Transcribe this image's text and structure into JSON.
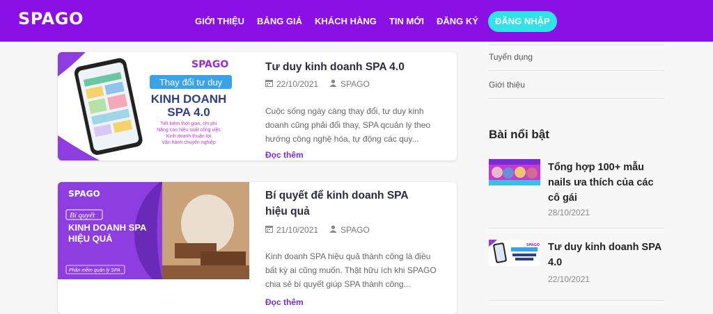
{
  "brand": {
    "logo": "SPAGO",
    "primary_color": "#8b10e6",
    "accent_color": "#2fe4e8"
  },
  "nav": {
    "items": [
      "GIỚI THIỆU",
      "BẢNG GIÁ",
      "KHÁCH HÀNG",
      "TIN MỚI",
      "ĐĂNG KÝ"
    ],
    "login": "ĐĂNG NHẬP"
  },
  "posts": [
    {
      "title": "Tư duy kinh doanh SPA 4.0",
      "date": "22/10/2021",
      "author": "SPAGO",
      "excerpt": "Cuộc sống ngày càng thay đổi, tư duy kinh doanh cũng phải đổi thay, SPA qcuản lý theo hướng công nghệ hóa, tự động các quy...",
      "read_more": "Đọc thêm",
      "thumb": {
        "brand": "SPAGO",
        "tag": "Thay đổi tư duy",
        "headline": "KINH DOANH SPA 4.0",
        "bullets": [
          "Tiết kiệm thời gian, chi phí",
          "Nâng cao hiệu suất công việc",
          "Kinh doanh thuận lợi",
          "Vận hành chuyên nghiệp"
        ]
      }
    },
    {
      "title": "Bí quyết để kinh doanh SPA hiệu quả",
      "date": "21/10/2021",
      "author": "SPAGO",
      "excerpt": "Kinh doanh SPA hiệu quả thành công là điều bất kỳ ai cũng muốn. Thật hữu ích khi SPAGO chia sẻ bí quyết giúp SPA thành công...",
      "read_more": "Đọc thêm",
      "thumb": {
        "brand": "SPAGO",
        "tag": "Bí quyết",
        "headline": "KINH DOANH SPA HIỆU QUẢ",
        "footer": "Phần mềm quản lý SPA"
      }
    }
  ],
  "sidebar": {
    "links": [
      "Tuyển dụng",
      "Giới thiệu"
    ],
    "featured_heading": "Bài nổi bật",
    "featured": [
      {
        "title": "Tổng hợp 100+ mẫu nails ưa thích của các cô gái",
        "date": "28/10/2021"
      },
      {
        "title": "Tư duy kinh doanh SPA 4.0",
        "date": "22/10/2021"
      }
    ]
  }
}
